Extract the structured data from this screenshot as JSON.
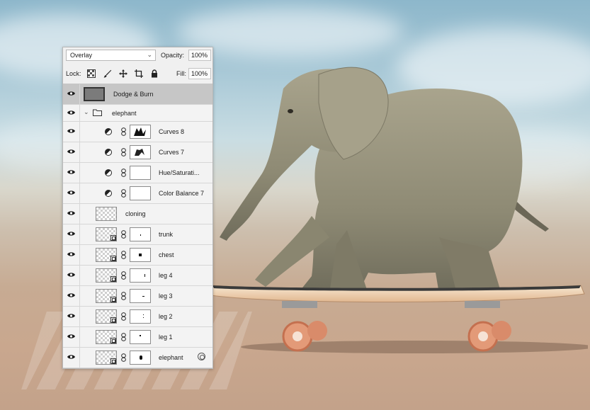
{
  "layers_panel": {
    "blend_mode": "Overlay",
    "opacity_label": "Opacity:",
    "opacity_value": "100%",
    "lock_label": "Lock:",
    "fill_label": "Fill:",
    "fill_value": "100%",
    "layers": [
      {
        "name": "Dodge & Burn",
        "kind": "pixel",
        "selected": true
      },
      {
        "name": "elephant",
        "kind": "group"
      },
      {
        "name": "Curves 8",
        "kind": "adjustment"
      },
      {
        "name": "Curves 7",
        "kind": "adjustment"
      },
      {
        "name": "Hue/Saturati...",
        "kind": "adjustment"
      },
      {
        "name": "Color Balance 7",
        "kind": "adjustment"
      },
      {
        "name": "cloning",
        "kind": "pixel"
      },
      {
        "name": "trunk",
        "kind": "smart-masked"
      },
      {
        "name": "chest",
        "kind": "smart-masked"
      },
      {
        "name": "leg 4",
        "kind": "smart-masked"
      },
      {
        "name": "leg 3",
        "kind": "smart-masked"
      },
      {
        "name": "leg 2",
        "kind": "smart-masked"
      },
      {
        "name": "leg 1",
        "kind": "smart-masked"
      },
      {
        "name": "elephant",
        "kind": "smart-masked-fx"
      }
    ]
  }
}
